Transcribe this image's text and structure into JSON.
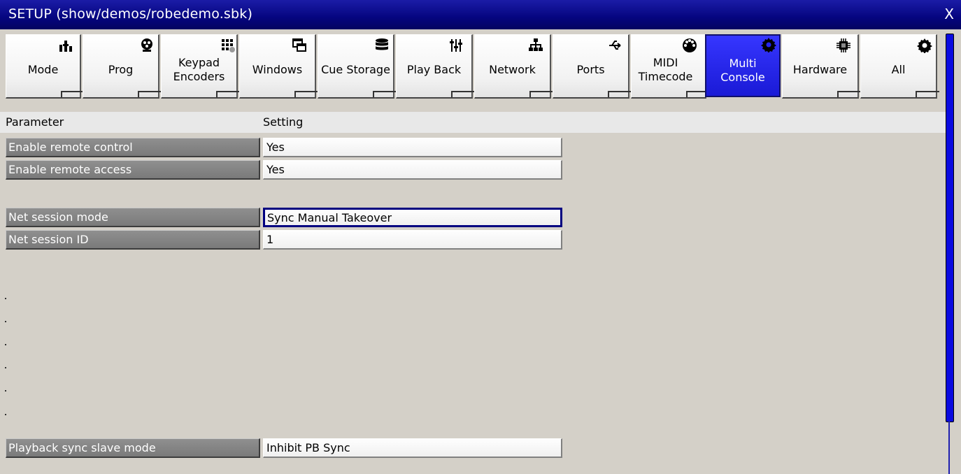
{
  "window": {
    "title": "SETUP (show/demos/robedemo.sbk)",
    "close_label": "X"
  },
  "tabs": [
    {
      "label": "Mode",
      "icon": "wrench-tools-icon"
    },
    {
      "label": "Prog",
      "icon": "fixture-icon"
    },
    {
      "label": "Keypad\nEncoders",
      "icon": "keypad-icon"
    },
    {
      "label": "Windows",
      "icon": "windows-icon"
    },
    {
      "label": "Cue Storage",
      "icon": "database-icon"
    },
    {
      "label": "Play Back",
      "icon": "faders-icon"
    },
    {
      "label": "Network",
      "icon": "network-icon"
    },
    {
      "label": "Ports",
      "icon": "usb-icon"
    },
    {
      "label": "MIDI\nTimecode",
      "icon": "midi-icon"
    },
    {
      "label": "Multi\nConsole",
      "icon": "gear-icon",
      "active": true
    },
    {
      "label": "Hardware",
      "icon": "chip-icon"
    },
    {
      "label": "All",
      "icon": "gear-icon"
    }
  ],
  "table": {
    "header": {
      "parameter": "Parameter",
      "setting": "Setting"
    },
    "rows": [
      {
        "name": "Enable remote control",
        "value": "Yes"
      },
      {
        "name": "Enable remote access",
        "value": "Yes"
      },
      {
        "name": "Net session mode",
        "value": "Sync Manual Takeover",
        "focused": true
      },
      {
        "name": "Net session ID",
        "value": "1"
      },
      {
        "name": "Playback sync slave mode",
        "value": "Inhibit PB Sync"
      }
    ]
  },
  "colors": {
    "titlebar": "#05057f",
    "active_tab": "#2424f0",
    "background": "#d4d0c8",
    "scrollbar": "#0a0ae0"
  }
}
